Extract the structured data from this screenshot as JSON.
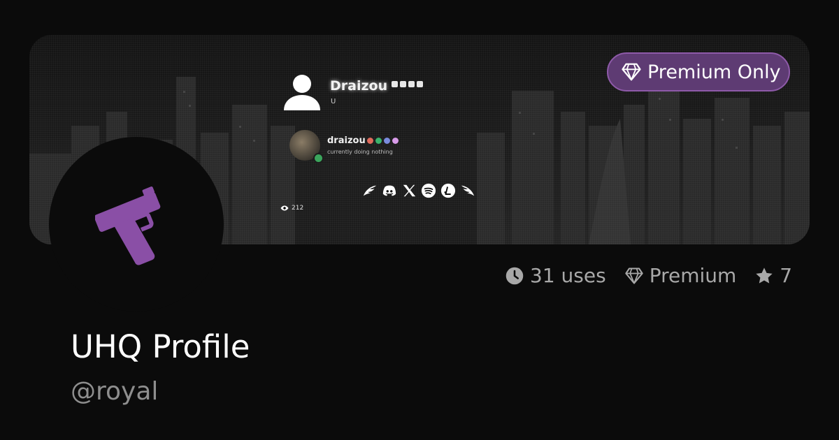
{
  "banner": {
    "premium_badge": "Premium Only",
    "profile": {
      "display_name": "Draizou",
      "bio": "U",
      "discord": {
        "username": "draizou",
        "activity": "currently doing nothing",
        "status": "online"
      },
      "socials": [
        "wing-left-icon",
        "discord-icon",
        "x-icon",
        "spotify-icon",
        "litecoin-icon",
        "wing-right-icon"
      ],
      "views": "212"
    }
  },
  "template": {
    "icon": "gun-icon",
    "accent_color": "#8a4fa6",
    "stats": {
      "uses": "31 uses",
      "tier": "Premium",
      "favorites": "7"
    },
    "name": "UHQ Profile",
    "author": "@royal"
  }
}
